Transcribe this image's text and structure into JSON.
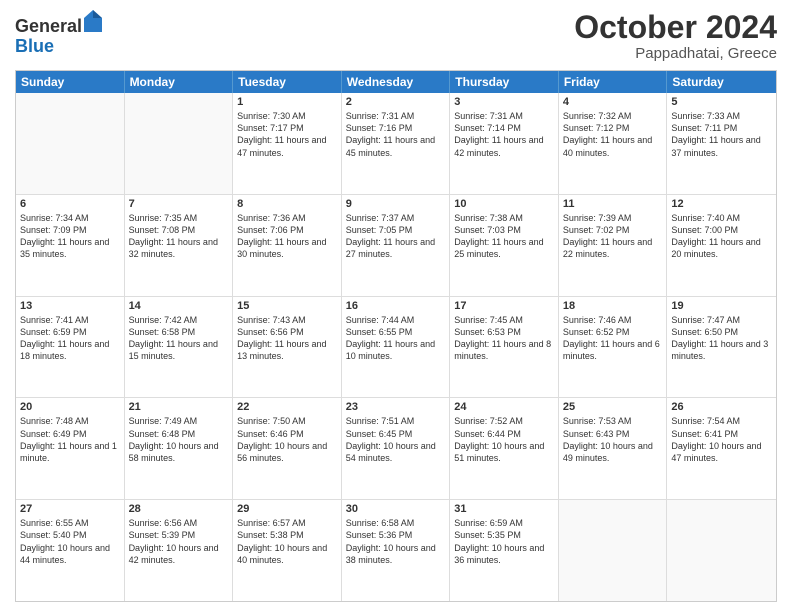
{
  "header": {
    "logo_general": "General",
    "logo_blue": "Blue",
    "month": "October 2024",
    "location": "Pappadhatai, Greece"
  },
  "weekdays": [
    "Sunday",
    "Monday",
    "Tuesday",
    "Wednesday",
    "Thursday",
    "Friday",
    "Saturday"
  ],
  "weeks": [
    [
      {
        "day": "",
        "sunrise": "",
        "sunset": "",
        "daylight": ""
      },
      {
        "day": "",
        "sunrise": "",
        "sunset": "",
        "daylight": ""
      },
      {
        "day": "1",
        "sunrise": "Sunrise: 7:30 AM",
        "sunset": "Sunset: 7:17 PM",
        "daylight": "Daylight: 11 hours and 47 minutes."
      },
      {
        "day": "2",
        "sunrise": "Sunrise: 7:31 AM",
        "sunset": "Sunset: 7:16 PM",
        "daylight": "Daylight: 11 hours and 45 minutes."
      },
      {
        "day": "3",
        "sunrise": "Sunrise: 7:31 AM",
        "sunset": "Sunset: 7:14 PM",
        "daylight": "Daylight: 11 hours and 42 minutes."
      },
      {
        "day": "4",
        "sunrise": "Sunrise: 7:32 AM",
        "sunset": "Sunset: 7:12 PM",
        "daylight": "Daylight: 11 hours and 40 minutes."
      },
      {
        "day": "5",
        "sunrise": "Sunrise: 7:33 AM",
        "sunset": "Sunset: 7:11 PM",
        "daylight": "Daylight: 11 hours and 37 minutes."
      }
    ],
    [
      {
        "day": "6",
        "sunrise": "Sunrise: 7:34 AM",
        "sunset": "Sunset: 7:09 PM",
        "daylight": "Daylight: 11 hours and 35 minutes."
      },
      {
        "day": "7",
        "sunrise": "Sunrise: 7:35 AM",
        "sunset": "Sunset: 7:08 PM",
        "daylight": "Daylight: 11 hours and 32 minutes."
      },
      {
        "day": "8",
        "sunrise": "Sunrise: 7:36 AM",
        "sunset": "Sunset: 7:06 PM",
        "daylight": "Daylight: 11 hours and 30 minutes."
      },
      {
        "day": "9",
        "sunrise": "Sunrise: 7:37 AM",
        "sunset": "Sunset: 7:05 PM",
        "daylight": "Daylight: 11 hours and 27 minutes."
      },
      {
        "day": "10",
        "sunrise": "Sunrise: 7:38 AM",
        "sunset": "Sunset: 7:03 PM",
        "daylight": "Daylight: 11 hours and 25 minutes."
      },
      {
        "day": "11",
        "sunrise": "Sunrise: 7:39 AM",
        "sunset": "Sunset: 7:02 PM",
        "daylight": "Daylight: 11 hours and 22 minutes."
      },
      {
        "day": "12",
        "sunrise": "Sunrise: 7:40 AM",
        "sunset": "Sunset: 7:00 PM",
        "daylight": "Daylight: 11 hours and 20 minutes."
      }
    ],
    [
      {
        "day": "13",
        "sunrise": "Sunrise: 7:41 AM",
        "sunset": "Sunset: 6:59 PM",
        "daylight": "Daylight: 11 hours and 18 minutes."
      },
      {
        "day": "14",
        "sunrise": "Sunrise: 7:42 AM",
        "sunset": "Sunset: 6:58 PM",
        "daylight": "Daylight: 11 hours and 15 minutes."
      },
      {
        "day": "15",
        "sunrise": "Sunrise: 7:43 AM",
        "sunset": "Sunset: 6:56 PM",
        "daylight": "Daylight: 11 hours and 13 minutes."
      },
      {
        "day": "16",
        "sunrise": "Sunrise: 7:44 AM",
        "sunset": "Sunset: 6:55 PM",
        "daylight": "Daylight: 11 hours and 10 minutes."
      },
      {
        "day": "17",
        "sunrise": "Sunrise: 7:45 AM",
        "sunset": "Sunset: 6:53 PM",
        "daylight": "Daylight: 11 hours and 8 minutes."
      },
      {
        "day": "18",
        "sunrise": "Sunrise: 7:46 AM",
        "sunset": "Sunset: 6:52 PM",
        "daylight": "Daylight: 11 hours and 6 minutes."
      },
      {
        "day": "19",
        "sunrise": "Sunrise: 7:47 AM",
        "sunset": "Sunset: 6:50 PM",
        "daylight": "Daylight: 11 hours and 3 minutes."
      }
    ],
    [
      {
        "day": "20",
        "sunrise": "Sunrise: 7:48 AM",
        "sunset": "Sunset: 6:49 PM",
        "daylight": "Daylight: 11 hours and 1 minute."
      },
      {
        "day": "21",
        "sunrise": "Sunrise: 7:49 AM",
        "sunset": "Sunset: 6:48 PM",
        "daylight": "Daylight: 10 hours and 58 minutes."
      },
      {
        "day": "22",
        "sunrise": "Sunrise: 7:50 AM",
        "sunset": "Sunset: 6:46 PM",
        "daylight": "Daylight: 10 hours and 56 minutes."
      },
      {
        "day": "23",
        "sunrise": "Sunrise: 7:51 AM",
        "sunset": "Sunset: 6:45 PM",
        "daylight": "Daylight: 10 hours and 54 minutes."
      },
      {
        "day": "24",
        "sunrise": "Sunrise: 7:52 AM",
        "sunset": "Sunset: 6:44 PM",
        "daylight": "Daylight: 10 hours and 51 minutes."
      },
      {
        "day": "25",
        "sunrise": "Sunrise: 7:53 AM",
        "sunset": "Sunset: 6:43 PM",
        "daylight": "Daylight: 10 hours and 49 minutes."
      },
      {
        "day": "26",
        "sunrise": "Sunrise: 7:54 AM",
        "sunset": "Sunset: 6:41 PM",
        "daylight": "Daylight: 10 hours and 47 minutes."
      }
    ],
    [
      {
        "day": "27",
        "sunrise": "Sunrise: 6:55 AM",
        "sunset": "Sunset: 5:40 PM",
        "daylight": "Daylight: 10 hours and 44 minutes."
      },
      {
        "day": "28",
        "sunrise": "Sunrise: 6:56 AM",
        "sunset": "Sunset: 5:39 PM",
        "daylight": "Daylight: 10 hours and 42 minutes."
      },
      {
        "day": "29",
        "sunrise": "Sunrise: 6:57 AM",
        "sunset": "Sunset: 5:38 PM",
        "daylight": "Daylight: 10 hours and 40 minutes."
      },
      {
        "day": "30",
        "sunrise": "Sunrise: 6:58 AM",
        "sunset": "Sunset: 5:36 PM",
        "daylight": "Daylight: 10 hours and 38 minutes."
      },
      {
        "day": "31",
        "sunrise": "Sunrise: 6:59 AM",
        "sunset": "Sunset: 5:35 PM",
        "daylight": "Daylight: 10 hours and 36 minutes."
      },
      {
        "day": "",
        "sunrise": "",
        "sunset": "",
        "daylight": ""
      },
      {
        "day": "",
        "sunrise": "",
        "sunset": "",
        "daylight": ""
      }
    ]
  ]
}
